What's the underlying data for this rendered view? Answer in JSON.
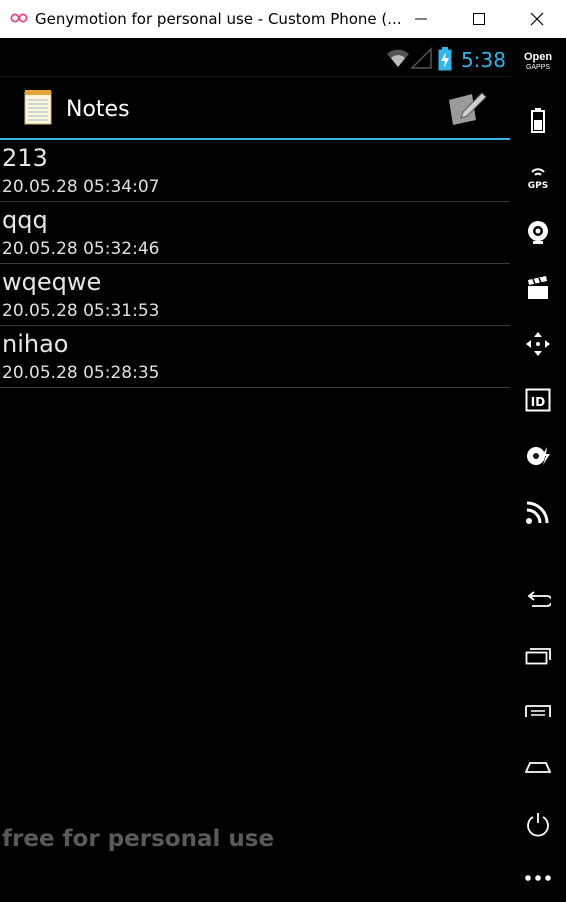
{
  "window": {
    "title": "Genymotion for personal use - Custom Phone (...",
    "minimize_icon": "minimize-icon",
    "maximize_icon": "maximize-icon",
    "close_icon": "close-icon"
  },
  "statusbar": {
    "time": "5:38",
    "icons": [
      "wifi-icon",
      "signal-icon",
      "battery-charging-icon"
    ],
    "accent_color": "#33b5e5"
  },
  "actionbar": {
    "title": "Notes",
    "app_icon": "notepad-icon",
    "action_icon": "compose-note-icon"
  },
  "notes": [
    {
      "title": "213",
      "date": "20.05.28 05:34:07"
    },
    {
      "title": "qqq",
      "date": "20.05.28 05:32:46"
    },
    {
      "title": "wqeqwe",
      "date": "20.05.28 05:31:53"
    },
    {
      "title": "nihao",
      "date": "20.05.28 05:28:35"
    }
  ],
  "watermark": "free for personal use",
  "sidepanel": {
    "opengapps_top": "Open",
    "opengapps_bottom": "GAPPS",
    "gps_label": "GPS",
    "id_label": "ID",
    "icons": [
      "battery-icon",
      "gps-icon",
      "webcam-icon",
      "media-clapper-icon",
      "dpad-icon",
      "identifiers-icon",
      "disk-io-icon",
      "cast-icon",
      "back-icon",
      "recent-apps-icon",
      "menu-icon",
      "home-icon",
      "power-icon",
      "more-icon"
    ]
  }
}
